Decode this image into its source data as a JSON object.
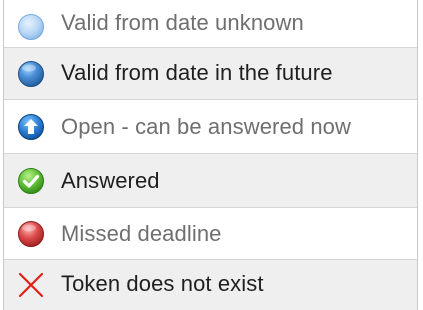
{
  "legend": {
    "items": [
      {
        "icon": "light-blue-circle-icon",
        "label": "Valid from date unknown",
        "color": "#a9cdf4"
      },
      {
        "icon": "blue-circle-icon",
        "label": "Valid from date in the future",
        "color": "#3a7fc2"
      },
      {
        "icon": "blue-up-arrow-circle-icon",
        "label": "Open - can be answered now",
        "color": "#1f6fc8"
      },
      {
        "icon": "green-check-circle-icon",
        "label": "Answered",
        "color": "#57b52f"
      },
      {
        "icon": "red-circle-icon",
        "label": "Missed deadline",
        "color": "#d03b3b"
      },
      {
        "icon": "red-x-icon",
        "label": "Token does not exist",
        "color": "#e0211b"
      }
    ]
  }
}
